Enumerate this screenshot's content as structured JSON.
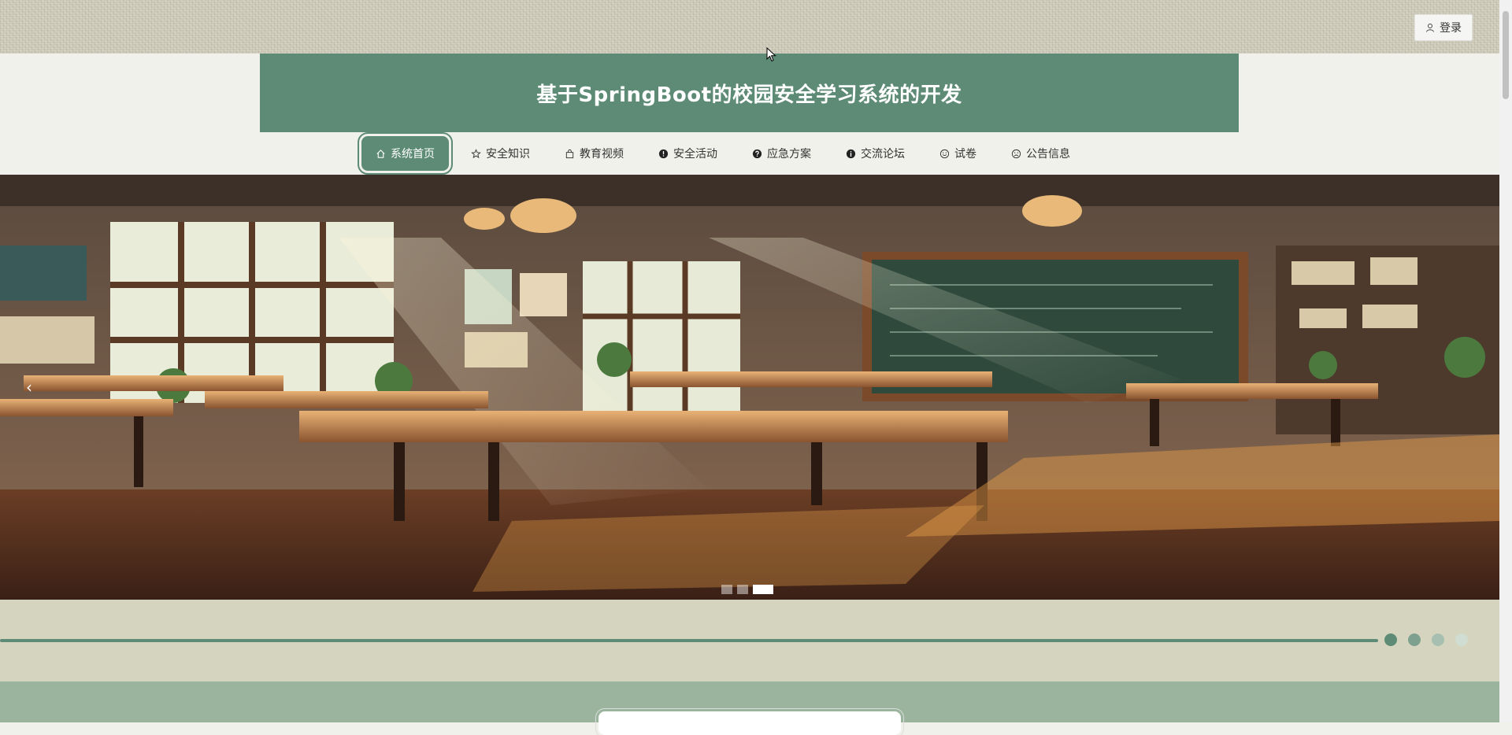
{
  "header": {
    "login_label": "登录",
    "title": "基于SpringBoot的校园安全学习系统的开发"
  },
  "nav": {
    "items": [
      {
        "label": "系统首页",
        "icon": "home-icon",
        "active": true
      },
      {
        "label": "安全知识",
        "icon": "star-icon",
        "active": false
      },
      {
        "label": "教育视频",
        "icon": "bag-icon",
        "active": false
      },
      {
        "label": "安全活动",
        "icon": "warning-icon",
        "active": false
      },
      {
        "label": "应急方案",
        "icon": "question-icon",
        "active": false
      },
      {
        "label": "交流论坛",
        "icon": "info-icon",
        "active": false
      },
      {
        "label": "试卷",
        "icon": "smile-icon",
        "active": false
      },
      {
        "label": "公告信息",
        "icon": "frown-icon",
        "active": false
      }
    ]
  },
  "banner": {
    "arrow": "‹",
    "slide_count": 3,
    "active_slide": 3
  },
  "colors": {
    "primary": "#5e8b76",
    "strip": "#d5d5bf",
    "bottom": "#9ab49e",
    "page_bg": "#f0f1ea"
  }
}
